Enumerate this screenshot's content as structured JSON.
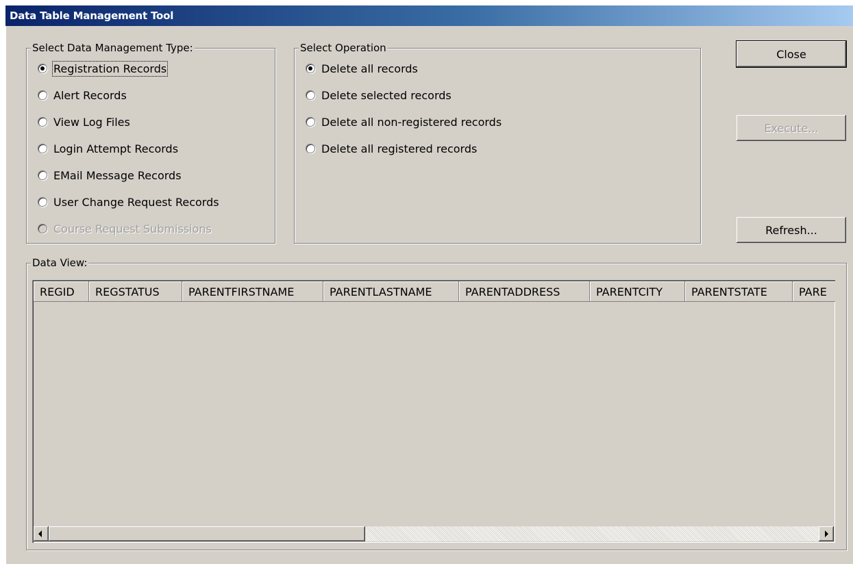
{
  "window": {
    "title": "Data Table Management Tool"
  },
  "management_type": {
    "legend": "Select Data Management Type:",
    "options": [
      {
        "label": "Registration Records",
        "checked": true,
        "enabled": true
      },
      {
        "label": "Alert Records",
        "checked": false,
        "enabled": true
      },
      {
        "label": "View Log Files",
        "checked": false,
        "enabled": true
      },
      {
        "label": "Login Attempt Records",
        "checked": false,
        "enabled": true
      },
      {
        "label": "EMail Message Records",
        "checked": false,
        "enabled": true
      },
      {
        "label": "User Change Request Records",
        "checked": false,
        "enabled": true
      },
      {
        "label": "Course Request Submissions",
        "checked": false,
        "enabled": false
      }
    ]
  },
  "operation": {
    "legend": "Select Operation",
    "options": [
      {
        "label": "Delete all records",
        "checked": true
      },
      {
        "label": "Delete selected records",
        "checked": false
      },
      {
        "label": "Delete all non-registered records",
        "checked": false
      },
      {
        "label": "Delete all registered records",
        "checked": false
      }
    ]
  },
  "buttons": {
    "close": "Close",
    "execute": "Execute...",
    "refresh": "Refresh..."
  },
  "data_view": {
    "legend": "Data View:",
    "columns": [
      "REGID",
      "REGSTATUS",
      "PARENTFIRSTNAME",
      "PARENTLASTNAME",
      "PARENTADDRESS",
      "PARENTCITY",
      "PARENTSTATE",
      "PARE"
    ]
  }
}
